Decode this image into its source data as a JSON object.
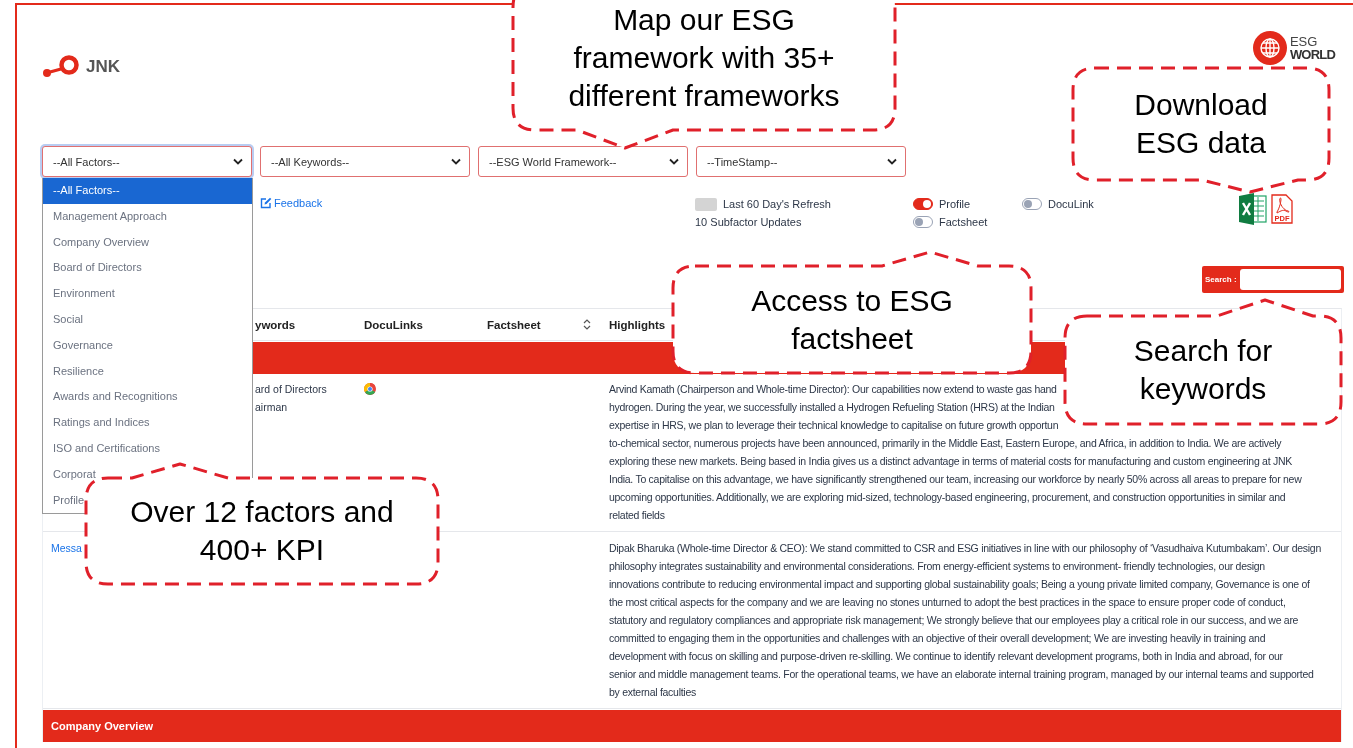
{
  "logo": {
    "text": "JNK"
  },
  "partner_logo": {
    "line_1": "ESG",
    "line_2": "WORLD"
  },
  "filters": [
    {
      "value": "--All Factors--",
      "expanded": true
    },
    {
      "value": "--All Keywords--",
      "expanded": false
    },
    {
      "value": "--ESG World Framework--",
      "expanded": false
    },
    {
      "value": "--TimeStamp--",
      "expanded": false
    }
  ],
  "factor_dropdown": {
    "options": [
      {
        "label": "--All Factors--",
        "selected": true
      },
      {
        "label": "Management Approach",
        "selected": false
      },
      {
        "label": "Company Overview",
        "selected": false
      },
      {
        "label": "Board of Directors",
        "selected": false
      },
      {
        "label": "Environment",
        "selected": false
      },
      {
        "label": "Social",
        "selected": false
      },
      {
        "label": "Governance",
        "selected": false
      },
      {
        "label": "Resilience",
        "selected": false
      },
      {
        "label": "Awards and Recognitions",
        "selected": false
      },
      {
        "label": "Ratings and Indices",
        "selected": false
      },
      {
        "label": "ISO and Certifications",
        "selected": false
      },
      {
        "label": "Corporat",
        "selected": false
      },
      {
        "label": "Profile",
        "selected": false
      }
    ]
  },
  "feedback_link": "Feedback",
  "refresh_legend": {
    "label": "Last 60 Day's Refresh",
    "updates": "10 Subfactor Updates"
  },
  "toggles": [
    {
      "label": "Profile",
      "on": true
    },
    {
      "label": "Factsheet",
      "on": false
    },
    {
      "label": "DocuLink",
      "on": false
    }
  ],
  "export": {
    "pdf_label": "PDF"
  },
  "search": {
    "label": "Search :"
  },
  "table": {
    "columns": [
      "ywords",
      "DocuLinks",
      "Factsheet",
      "Highlights"
    ],
    "rows": [
      {
        "kind": "group"
      },
      {
        "kind": "entry",
        "keywords": [
          "ard of Directors",
          "airman"
        ],
        "doculink": true,
        "highlights": [
          "Arvind Kamath (Chairperson and Whole-time Director): Our capabilities now extend to waste gas hand",
          "hydrogen. During the year, we successfully installed a Hydrogen Refueling Station (HRS) at the Indian",
          "expertise in HRS, we plan to leverage their technical knowledge to capitalise on future growth opportun",
          "to-chemical sector, numerous projects have been announced, primarily in the Middle East, Eastern Europe, and Africa, in addition to India. We are actively",
          "exploring these new markets. Being based in India gives us a distinct advantage in terms of material costs for manufacturing and custom engineering at JNK",
          "India. To capitalise on this advantage, we have significantly strengthened our team, increasing our workforce by nearly 50% across all areas to prepare for new",
          "upcoming opportunities. Additionally, we are exploring mid-sized, technology-based engineering, procurement, and construction opportunities in similar and",
          "related fields"
        ]
      },
      {
        "kind": "entry",
        "link": "Messa",
        "doculink": false,
        "highlights": [
          "Dipak Bharuka (Whole-time Director & CEO): We stand committed to CSR and ESG initiatives in line with our philosophy of ‘Vasudhaiva Kutumbakam’. Our design",
          "philosophy integrates sustainability and environmental considerations. From energy-efficient systems to environment- friendly technologies, our design",
          "innovations contribute to reducing environmental impact and supporting global sustainability goals; Being a young private limited company, Governance is one of",
          "the most critical aspects for the company and we are leaving no stones unturned to adopt the best practices in the space to ensure proper code of conduct,",
          "statutory and regulatory compliances and appropriate risk management; We strongly believe that our employees play a critical role in our success, and we are",
          "committed to engaging them in the opportunities and challenges with an objective of their overall development; We are investing heavily in training and",
          "development with focus on skilling and purpose-driven re-skilling. We continue to identify relevant development programs, both in India and abroad, for our",
          "senior and middle management teams. For the operational teams, we have an elaborate internal training program, managed by our internal teams and supported",
          "by external faculties"
        ]
      },
      {
        "kind": "group",
        "label": "Company Overview"
      }
    ]
  },
  "callouts": [
    {
      "lines": [
        "Map our ESG",
        "framework with 35+",
        "different frameworks"
      ]
    },
    {
      "lines": [
        "Download",
        "ESG data"
      ]
    },
    {
      "lines": [
        "Access to ESG",
        "factsheet"
      ]
    },
    {
      "lines": [
        "Search for",
        "keywords"
      ]
    },
    {
      "lines": [
        "Over 12 factors and",
        "400+ KPI"
      ]
    }
  ]
}
